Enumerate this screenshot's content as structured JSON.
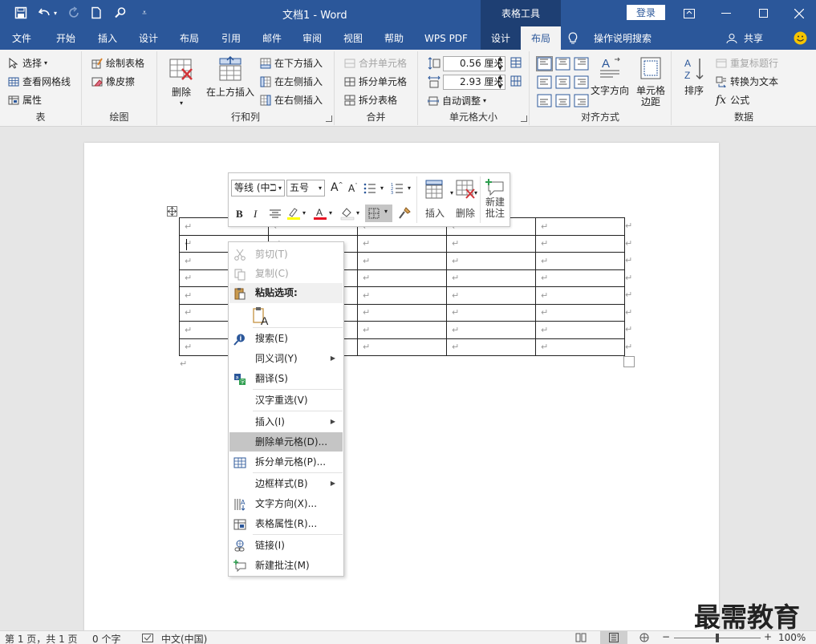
{
  "titlebar": {
    "doc_title": "文档1  -  Word",
    "context_group": "表格工具",
    "login": "登录"
  },
  "tabs": [
    {
      "label": "文件"
    },
    {
      "label": "开始"
    },
    {
      "label": "插入"
    },
    {
      "label": "设计"
    },
    {
      "label": "布局"
    },
    {
      "label": "引用"
    },
    {
      "label": "邮件"
    },
    {
      "label": "审阅"
    },
    {
      "label": "视图"
    },
    {
      "label": "帮助"
    },
    {
      "label": "WPS PDF"
    },
    {
      "label": "设计"
    },
    {
      "label": "布局"
    }
  ],
  "tellme": "操作说明搜索",
  "share": "共享",
  "ribbon": {
    "table_group": {
      "select": "选择",
      "gridlines": "查看网格线",
      "props": "属性",
      "label": "表"
    },
    "draw_group": {
      "draw": "绘制表格",
      "eraser": "橡皮擦",
      "label": "绘图"
    },
    "rows_group": {
      "delete": "删除",
      "insert_above": "在上方插入",
      "insert_below": "在下方插入",
      "insert_left": "在左侧插入",
      "insert_right": "在右侧插入",
      "label": "行和列"
    },
    "merge_group": {
      "merge": "合并单元格",
      "split": "拆分单元格",
      "split_table": "拆分表格",
      "label": "合并"
    },
    "size_group": {
      "height": "0.56 厘米",
      "width": "2.93 厘米",
      "autofit": "自动调整",
      "label": "单元格大小"
    },
    "align_group": {
      "text_dir": "文字方向",
      "margins_1": "单元格",
      "margins_2": "边距",
      "label": "对齐方式"
    },
    "data_group": {
      "sort": "排序",
      "repeat_header": "重复标题行",
      "convert": "转换为文本",
      "formula": "公式",
      "label": "数据"
    }
  },
  "minitoolbar": {
    "font": "等线 (中ℶ",
    "size": "五号",
    "insert": "插入",
    "delete": "删除",
    "comment_1": "新建",
    "comment_2": "批注"
  },
  "contextmenu": {
    "cut": "剪切(T)",
    "copy": "复制(C)",
    "paste_header": "粘贴选项:",
    "search": "搜索(E)",
    "synonyms": "同义词(Y)",
    "translate": "翻译(S)",
    "reconvert": "汉字重选(V)",
    "insert": "插入(I)",
    "delete_cells": "删除单元格(D)...",
    "split_cells": "拆分单元格(P)...",
    "border_styles": "边框样式(B)",
    "text_direction": "文字方向(X)...",
    "table_props": "表格属性(R)...",
    "link": "链接(I)",
    "new_comment": "新建批注(M)"
  },
  "paragraph_mark": "↵",
  "statusbar": {
    "page": "第 1 页，共 1 页",
    "words": "0 个字",
    "lang": "中文(中国)",
    "zoom": "100%"
  },
  "watermark": "最需教育",
  "colors": {
    "brand": "#2b579a",
    "ctx_dark": "#1e3f73",
    "highlight": "#c5c5c5"
  }
}
